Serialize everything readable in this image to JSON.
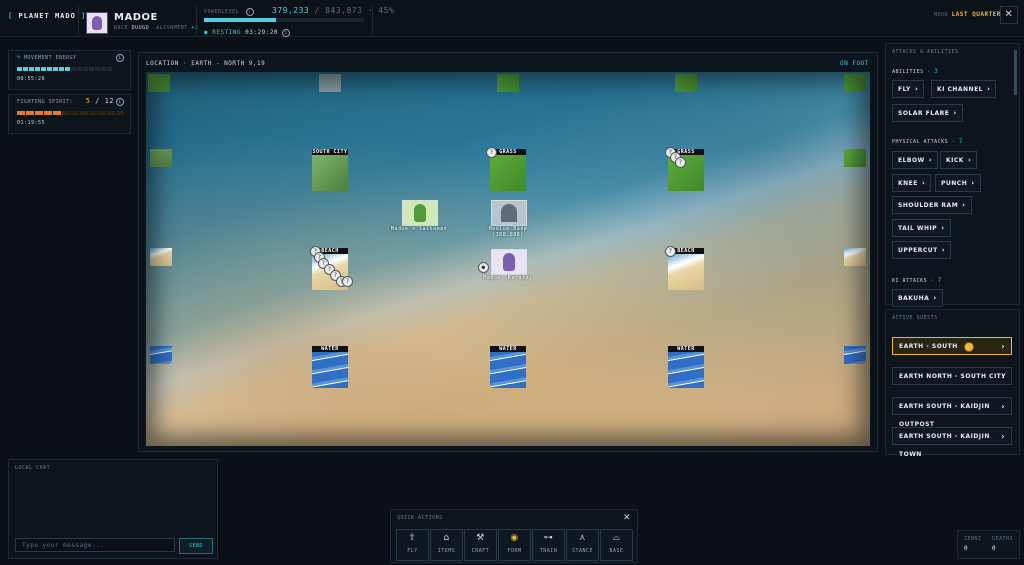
{
  "header": {
    "brand": "PLANET MADO",
    "player_name": "MADOE",
    "race_label": "RACE",
    "race": "DUUGO",
    "alignment_label": "ALIGNMENT",
    "alignment": "+3",
    "powerlevel_label": "POWERLEVEL",
    "powerlevel": "379,233",
    "powerlevel_max": "/ 843,873 · 45%",
    "powerlevel_fraction": 0.45,
    "resting_label": "● RESTING",
    "resting_time": "03:29:20",
    "moon_label": "MOON",
    "moon_phase": "LAST QUARTER"
  },
  "movement": {
    "title": "MOVEMENT ENERGY",
    "time": "00:55:26",
    "filled": 9,
    "total": 16
  },
  "fighting": {
    "title": "FIGHTING SPIRIT:",
    "count": "5",
    "max": "/ 12",
    "time": "01:19:55",
    "filled": 5,
    "total": 12
  },
  "map": {
    "location": "LOCATION · EARTH - NORTH 9,19",
    "mode": "ON FOOT",
    "tiles": {
      "south_city": "SOUTH CITY",
      "grass": "GRASS",
      "beach": "BEACH",
      "water": "WATER"
    },
    "objects": {
      "saibaman": "Madoe's Saibaman",
      "base": "Medium Base (308,888)",
      "player": "Madoe (Karate)"
    }
  },
  "abilities": {
    "title": "ATTACKS & ABILITIES",
    "abilities_label": "ABILITIES",
    "abilities_count": "3",
    "abilities": [
      "FLY",
      "KI CHANNEL",
      "SOLAR FLARE"
    ],
    "physical_label": "PHYSICAL ATTACKS",
    "physical_count": "7",
    "physical": [
      "ELBOW",
      "KICK",
      "KNEE",
      "PUNCH",
      "SHOULDER RAM",
      "TAIL WHIP",
      "UPPERCUT"
    ],
    "ki_label": "KI ATTACKS",
    "ki_count": "7",
    "ki": [
      "BAKUHA"
    ],
    "arrow": "›"
  },
  "quests": {
    "title": "ACTIVE QUESTS",
    "items": [
      "EARTH - SOUTH",
      "EARTH NORTH - SOUTH CITY",
      "EARTH SOUTH - KAIDJIN OUTPOST",
      "EARTH SOUTH - KAIDJIN TOWN"
    ]
  },
  "chat": {
    "title": "LOCAL CHAT",
    "placeholder": "Type your message...",
    "send": "SEND"
  },
  "quick_actions": {
    "title": "QUICK ACTIONS",
    "items": [
      {
        "label": "FLY",
        "icon": "arrow-up-icon"
      },
      {
        "label": "ITEMS",
        "icon": "bag-icon"
      },
      {
        "label": "CRAFT",
        "icon": "hammer-icon"
      },
      {
        "label": "FORM",
        "icon": "aura-icon"
      },
      {
        "label": "TRAIN",
        "icon": "dumbbell-icon"
      },
      {
        "label": "STANCE",
        "icon": "stance-icon"
      },
      {
        "label": "BASE",
        "icon": "dome-icon"
      }
    ]
  },
  "stats": {
    "zenni_label": "ZENNI",
    "zenni": "0",
    "deaths_label": "DEATHS",
    "deaths": "0"
  },
  "colors": {
    "accent": "#4fd1e6",
    "gold": "#f0b63d",
    "spirit": "#e67e22"
  }
}
